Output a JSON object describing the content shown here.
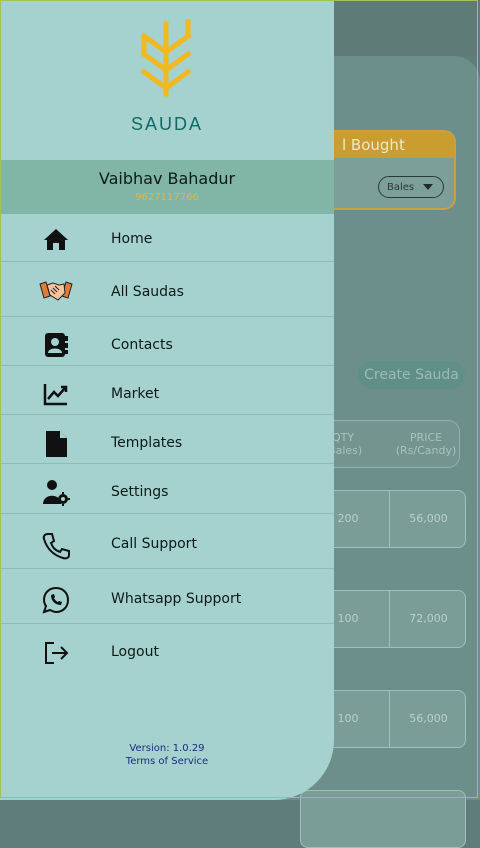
{
  "background": {
    "card_title": "l Bought",
    "unit_select": "Bales",
    "create_button": "Create Sauda",
    "table": {
      "qty_header": "QTY",
      "qty_sub": "(Bales)",
      "price_header": "PRICE",
      "price_sub": "(Rs/Candy)"
    },
    "rows": [
      {
        "qty": "200",
        "price": "56,000"
      },
      {
        "qty": "100",
        "price": "72,000"
      },
      {
        "qty": "100",
        "price": "56,000"
      }
    ]
  },
  "drawer": {
    "brand": "SAUDA",
    "user_name": "Vaibhav Bahadur",
    "user_phone": "9627117766",
    "menu": [
      {
        "label": "Home",
        "icon": "home-icon"
      },
      {
        "label": "All Saudas",
        "icon": "handshake-icon"
      },
      {
        "label": "Contacts",
        "icon": "contacts-icon"
      },
      {
        "label": "Market",
        "icon": "chart-trend-icon"
      },
      {
        "label": "Templates",
        "icon": "document-icon"
      },
      {
        "label": "Settings",
        "icon": "user-settings-icon"
      },
      {
        "label": "Call Support",
        "icon": "phone-icon"
      },
      {
        "label": "Whatsapp Support",
        "icon": "whatsapp-icon"
      },
      {
        "label": "Logout",
        "icon": "logout-icon"
      }
    ],
    "version": "Version: 1.0.29",
    "terms": "Terms of Service"
  },
  "colors": {
    "drawer_bg": "#a5d1ce",
    "user_band": "#81b6a7",
    "brand": "#0f6b64",
    "accent_gold": "#e8b23c",
    "link_blue": "#1a2c80"
  }
}
